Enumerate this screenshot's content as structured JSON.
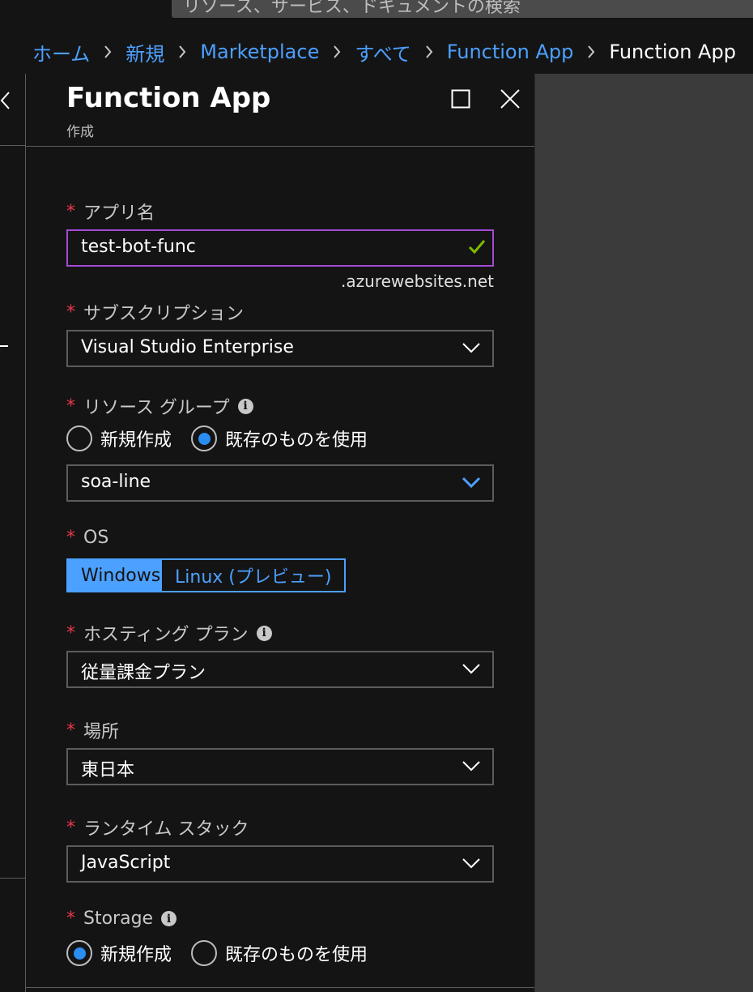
{
  "search": {
    "placeholder": "リソース、サービス、ドキュメントの検索"
  },
  "breadcrumb": [
    {
      "label": "ホーム"
    },
    {
      "label": "新規"
    },
    {
      "label": "Marketplace"
    },
    {
      "label": "すべて"
    },
    {
      "label": "Function App"
    },
    {
      "label": "Function App"
    }
  ],
  "blade": {
    "title": "Function App",
    "subtitle": "作成"
  },
  "form": {
    "app_name": {
      "label": "アプリ名",
      "value": "test-bot-func",
      "suffix": ".azurewebsites.net"
    },
    "subscription": {
      "label": "サブスクリプション",
      "value": "Visual Studio Enterprise"
    },
    "resource_group": {
      "label": "リソース グループ",
      "options": [
        "新規作成",
        "既存のものを使用"
      ],
      "selected": "既存のものを使用",
      "value": "soa-line"
    },
    "os": {
      "label": "OS",
      "options": [
        "Windows",
        "Linux (プレビュー)"
      ],
      "selected": "Windows"
    },
    "hosting_plan": {
      "label": "ホスティング プラン",
      "value": "従量課金プラン"
    },
    "location": {
      "label": "場所",
      "value": "東日本"
    },
    "runtime_stack": {
      "label": "ランタイム スタック",
      "value": "JavaScript"
    },
    "storage": {
      "label": "Storage",
      "options": [
        "新規作成",
        "既存のものを使用"
      ],
      "selected": "新規作成"
    }
  },
  "colors": {
    "link": "#4ca0ff",
    "required": "#e8374a",
    "focus_border": "#a34bd6",
    "valid_check": "#7fba00",
    "radio_selected": "#2a8df0"
  }
}
